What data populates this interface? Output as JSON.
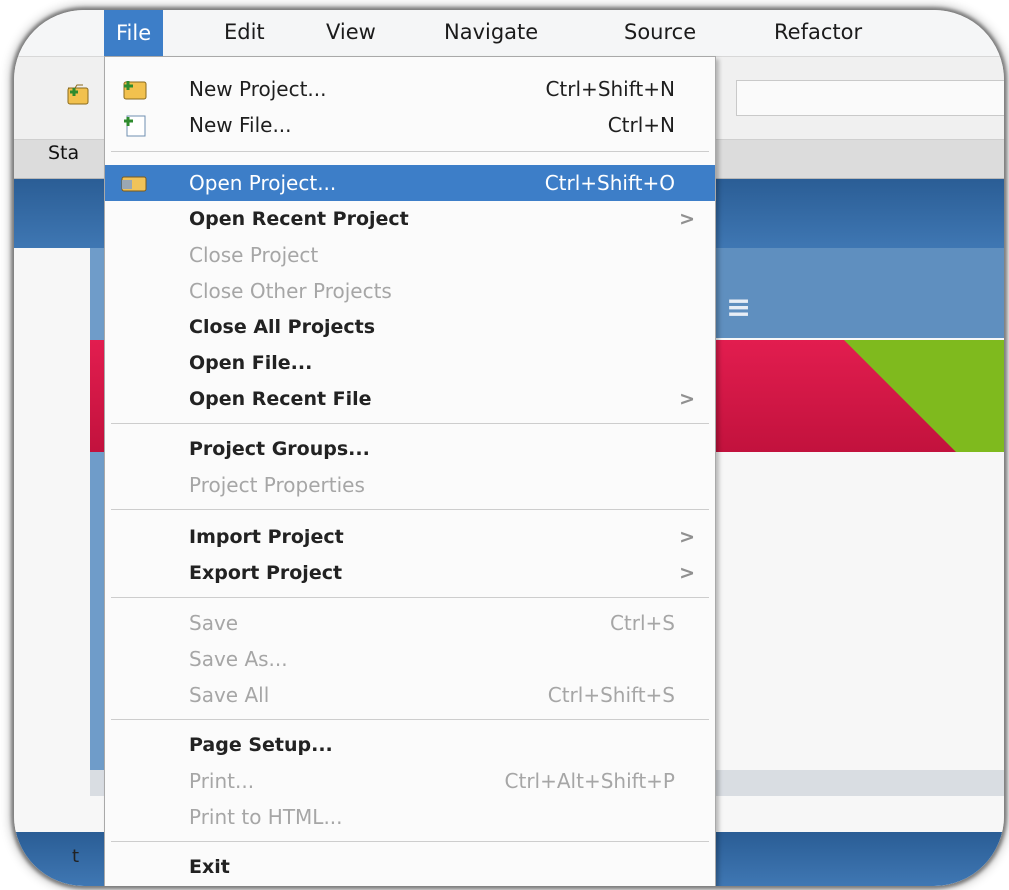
{
  "menubar": {
    "items": [
      "File",
      "Edit",
      "View",
      "Navigate",
      "Source",
      "Refactor"
    ]
  },
  "tab": {
    "label": "Sta"
  },
  "bottom": {
    "label": "t"
  },
  "file_menu": {
    "items": [
      {
        "label": "New Project...",
        "shortcut": "Ctrl+Shift+N",
        "icon": "new-project-icon"
      },
      {
        "label": "New File...",
        "shortcut": "Ctrl+N",
        "icon": "new-file-icon"
      },
      {
        "label": "Open Project...",
        "shortcut": "Ctrl+Shift+O",
        "icon": "open-project-icon",
        "selected": true
      },
      {
        "label": "Open Recent Project",
        "arrow": ">"
      },
      {
        "label": "Close Project",
        "disabled": true
      },
      {
        "label": "Close Other Projects",
        "disabled": true
      },
      {
        "label": "Close All Projects"
      },
      {
        "label": "Open File..."
      },
      {
        "label": "Open Recent File",
        "arrow": ">"
      },
      {
        "label": "Project Groups..."
      },
      {
        "label": "Project Properties",
        "disabled": true
      },
      {
        "label": "Import Project",
        "arrow": ">"
      },
      {
        "label": "Export Project",
        "arrow": ">"
      },
      {
        "label": "Save",
        "shortcut": "Ctrl+S",
        "disabled": true
      },
      {
        "label": "Save As...",
        "disabled": true
      },
      {
        "label": "Save All",
        "shortcut": "Ctrl+Shift+S",
        "disabled": true
      },
      {
        "label": "Page Setup..."
      },
      {
        "label": "Print...",
        "shortcut": "Ctrl+Alt+Shift+P",
        "disabled": true
      },
      {
        "label": "Print to HTML...",
        "disabled": true
      },
      {
        "label": "Exit"
      }
    ]
  },
  "colors": {
    "menu_highlight": "#3d7ec8",
    "start_page_blue": "#3f77b3",
    "start_page_red": "#e21d4f",
    "start_page_green": "#7fba1e"
  }
}
